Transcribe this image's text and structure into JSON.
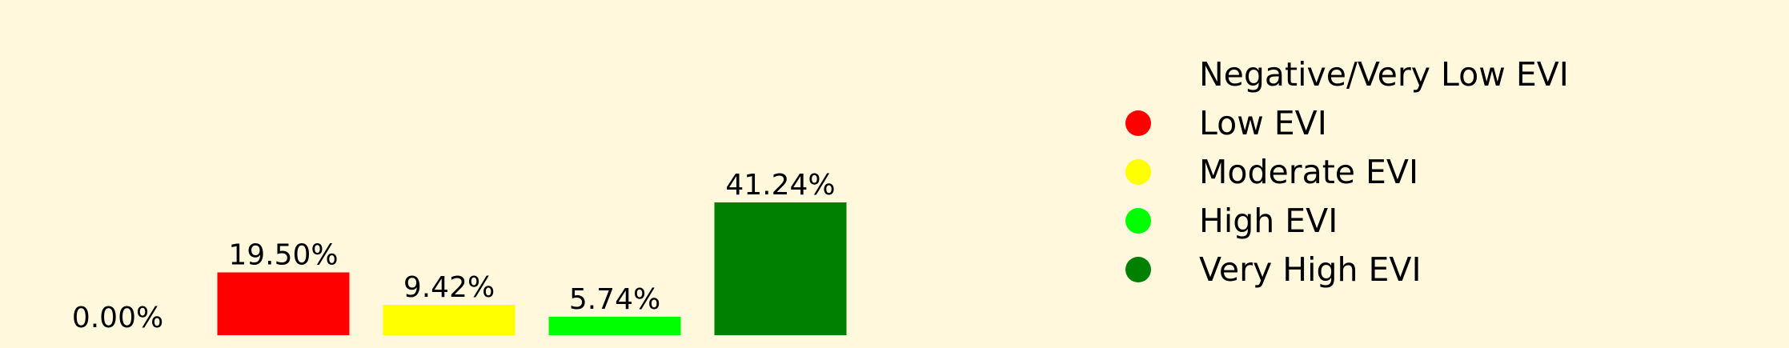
{
  "chart_data": {
    "type": "bar",
    "categories": [
      "Negative/Very Low EVI",
      "Low EVI",
      "Moderate EVI",
      "High EVI",
      "Very High EVI"
    ],
    "values": [
      0.0,
      19.5,
      9.42,
      5.74,
      41.24
    ],
    "value_labels": [
      "0.00%",
      "19.50%",
      "9.42%",
      "5.74%",
      "41.24%"
    ],
    "colors": [
      "#fff8dc",
      "#ff0000",
      "#ffff00",
      "#00ff00",
      "#008000"
    ],
    "legend": {
      "position": "right",
      "entries": [
        "Negative/Very Low EVI",
        "Low EVI",
        "Moderate EVI",
        "High EVI",
        "Very High EVI"
      ]
    },
    "background": "#fff8dc",
    "grid": false,
    "axes_visible": false
  }
}
